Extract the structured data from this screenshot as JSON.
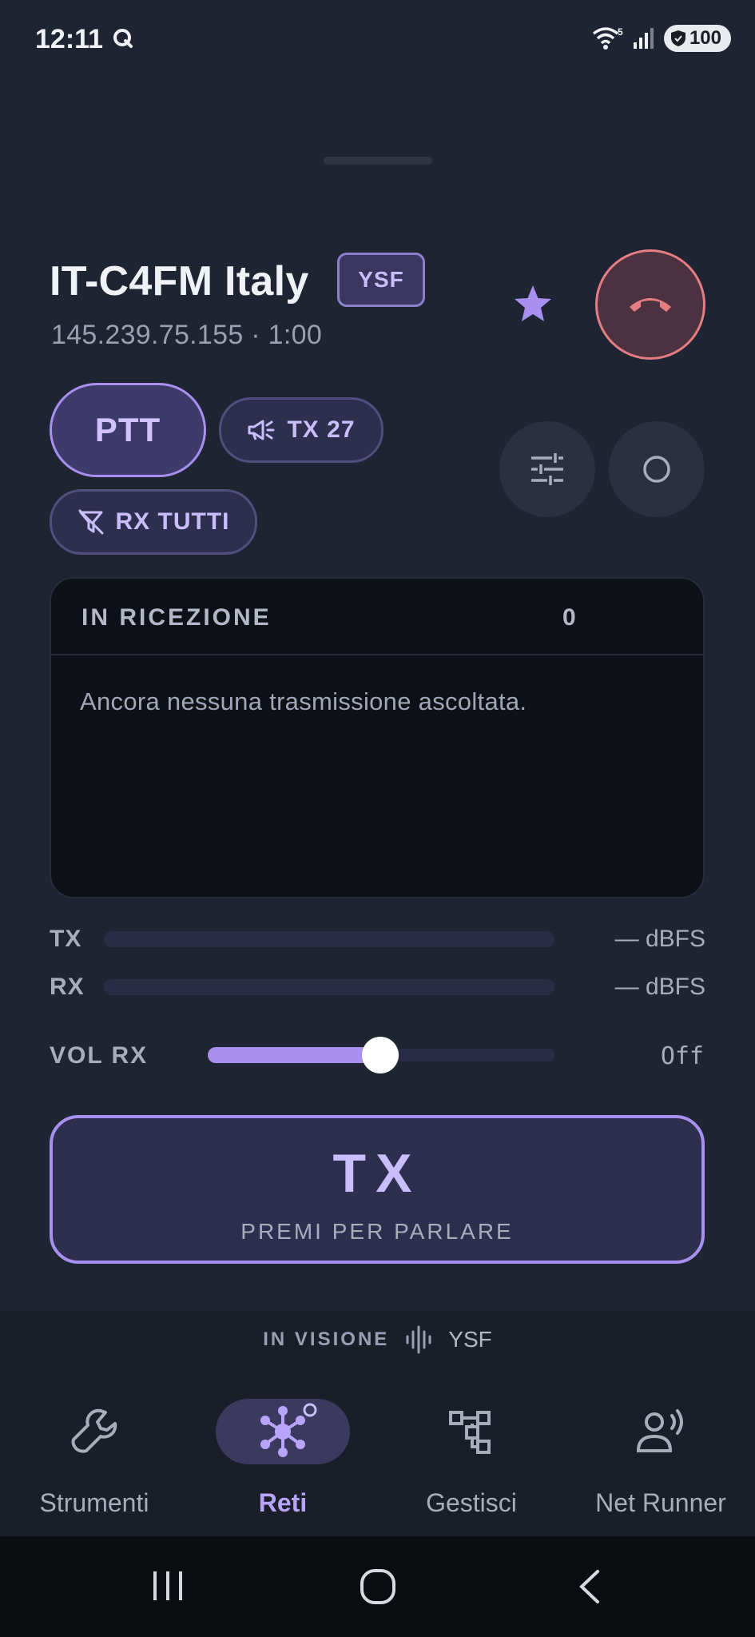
{
  "status_bar": {
    "time": "12:11",
    "network_badge": "5",
    "battery": "100"
  },
  "network": {
    "title": "IT-C4FM Italy",
    "mode": "YSF",
    "subtitle": "145.239.75.155 · 1:00",
    "favorite": true
  },
  "controls": {
    "ptt_label": "PTT",
    "tx_label": "TX 27",
    "rx_label": "RX TUTTI"
  },
  "receiving": {
    "title": "IN RICEZIONE",
    "count": "0",
    "empty_text": "Ancora nessuna trasmissione ascoltata."
  },
  "meters": {
    "tx": {
      "label": "TX",
      "value": "— dBFS"
    },
    "rx": {
      "label": "RX",
      "value": "— dBFS"
    }
  },
  "volume": {
    "label": "VOL RX",
    "value": "Off",
    "level": 0.5
  },
  "tx_button": {
    "big": "TX",
    "small": "PREMI PER PARLARE"
  },
  "in_visione": {
    "label": "IN VISIONE",
    "mode": "YSF"
  },
  "nav": [
    {
      "label": "Strumenti",
      "icon": "wrench-icon",
      "active": false
    },
    {
      "label": "Reti",
      "icon": "network-hub-icon",
      "active": true
    },
    {
      "label": "Gestisci",
      "icon": "hierarchy-icon",
      "active": false
    },
    {
      "label": "Net Runner",
      "icon": "person-voice-icon",
      "active": false
    }
  ],
  "colors": {
    "background": "#1f2433",
    "accent": "#a88ff0",
    "hangup": "#e57d83",
    "panel": "#0d1016"
  }
}
